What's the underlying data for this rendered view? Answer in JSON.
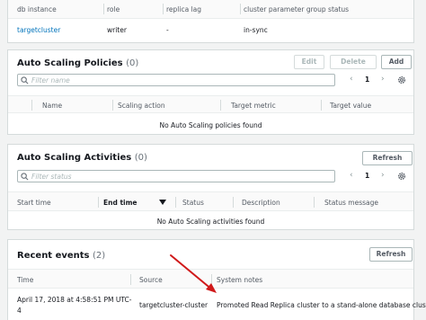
{
  "instances_table": {
    "headers": [
      "db instance",
      "role",
      "replica lag",
      "cluster parameter group status"
    ],
    "row": {
      "db_instance": "targetcluster",
      "role": "writer",
      "replica_lag": "-",
      "param_status": "in-sync"
    }
  },
  "scaling_policies": {
    "title": "Auto Scaling Policies",
    "count": "(0)",
    "edit_label": "Edit",
    "delete_label": "Delete",
    "add_label": "Add",
    "filter_placeholder": "Filter name",
    "page": "1",
    "headers": [
      "Name",
      "Scaling action",
      "Target metric",
      "Target value"
    ],
    "empty_message": "No Auto Scaling policies found"
  },
  "scaling_activities": {
    "title": "Auto Scaling Activities",
    "count": "(0)",
    "refresh_label": "Refresh",
    "filter_placeholder": "Filter status",
    "page": "1",
    "headers": [
      "Start time",
      "End time",
      "Status",
      "Description",
      "Status message"
    ],
    "empty_message": "No Auto Scaling activities found"
  },
  "recent_events": {
    "title": "Recent events",
    "count": "(2)",
    "refresh_label": "Refresh",
    "headers": [
      "Time",
      "Source",
      "System notes"
    ],
    "row": {
      "time_line1": "April 17, 2018 at 4:58:51 PM UTC-",
      "time_line2": "4",
      "source": "targetcluster-cluster",
      "notes": "Promoted Read Replica cluster to a stand-alone database cluster."
    }
  },
  "colors": {
    "link": "#0073bb",
    "annotation_arrow": "#d0191a"
  }
}
